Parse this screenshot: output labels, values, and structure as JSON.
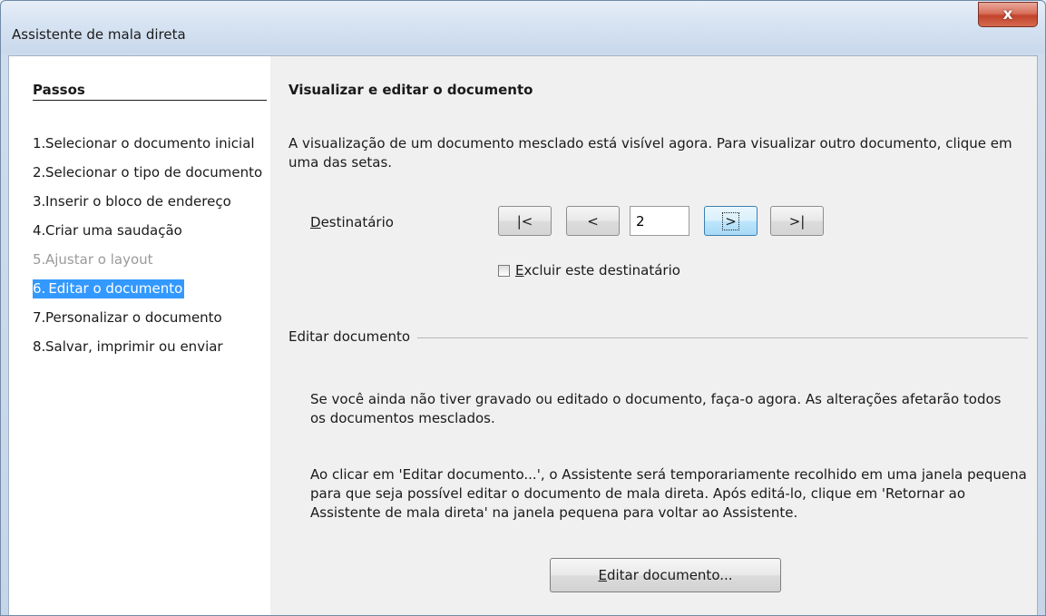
{
  "window": {
    "title": "Assistente de mala direta",
    "close_label": "x"
  },
  "sidebar": {
    "title": "Passos",
    "steps": [
      {
        "num": "1.",
        "label": "Selecionar o documento inicial"
      },
      {
        "num": "2.",
        "label": "Selecionar o tipo de documento"
      },
      {
        "num": "3.",
        "label": "Inserir o bloco de endereço"
      },
      {
        "num": "4.",
        "label": "Criar uma saudação"
      },
      {
        "num": "5.",
        "label": "Ajustar o layout"
      },
      {
        "num": "6.",
        "label": "Editar o documento"
      },
      {
        "num": "7.",
        "label": "Personalizar o documento"
      },
      {
        "num": "8.",
        "label": "Salvar, imprimir ou enviar"
      }
    ]
  },
  "main": {
    "heading": "Visualizar e editar o documento",
    "description": "A visualização de um documento mesclado está visível agora. Para visualizar outro documento, clique em uma das setas.",
    "recipient": {
      "label_first": "D",
      "label_rest": "estinatário",
      "first_label": "|<",
      "prev_label": "<",
      "value": "2",
      "next_label": ">",
      "last_label": ">|"
    },
    "exclude": {
      "label_first": "E",
      "label_rest": "xcluir este destinatário"
    },
    "edit_section": {
      "title": "Editar documento",
      "para1": "Se você ainda não tiver gravado ou editado o documento, faça-o agora. As alterações afetarão todos os documentos mesclados.",
      "para2": "Ao clicar em 'Editar documento...', o Assistente será temporariamente recolhido em uma janela pequena para que seja possível editar o documento de mala direta. Após editá-lo, clique em 'Retornar ao Assistente de mala direta' na janela pequena para voltar ao Assistente.",
      "button_first": "E",
      "button_rest": "ditar documento..."
    }
  }
}
